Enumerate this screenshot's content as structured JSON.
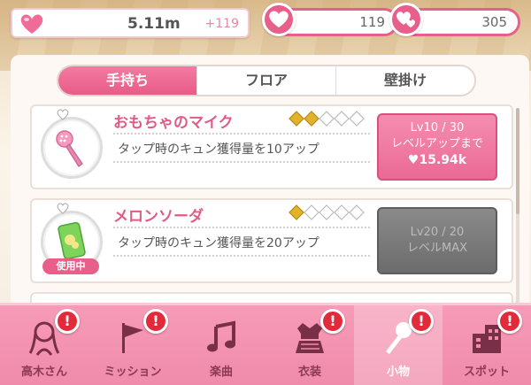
{
  "header": {
    "money_value": "5.11m",
    "money_delta": "+119",
    "heart_count": "119",
    "kyun_count": "305"
  },
  "tabs": [
    {
      "label": "手持ち",
      "active": true
    },
    {
      "label": "フロア",
      "active": false
    },
    {
      "label": "壁掛け",
      "active": false
    }
  ],
  "items": [
    {
      "name": "おもちゃのマイク",
      "description": "タップ時のキュン獲得量を10アップ",
      "rating": 2,
      "rating_max": 5,
      "level_text": "Lv10 / 30",
      "level_caption": "レベルアップまで",
      "cost": "♥15.94k",
      "button_state": "upgrade",
      "in_use": false
    },
    {
      "name": "メロンソーダ",
      "description": "タップ時のキュン獲得量を20アップ",
      "rating": 1,
      "rating_max": 5,
      "level_text": "Lv20 / 20",
      "level_caption": "レベルMAX",
      "cost": "",
      "button_state": "max",
      "in_use": true,
      "in_use_label": "使用中"
    }
  ],
  "nav": [
    {
      "label": "高木さん",
      "icon": "person-icon",
      "alert": "!"
    },
    {
      "label": "ミッション",
      "icon": "flag-icon",
      "alert": "!"
    },
    {
      "label": "楽曲",
      "icon": "music-note-icon",
      "alert": ""
    },
    {
      "label": "衣装",
      "icon": "costume-icon",
      "alert": "!"
    },
    {
      "label": "小物",
      "icon": "microphone-icon",
      "alert": "!",
      "active": true
    },
    {
      "label": "スポット",
      "icon": "building-icon",
      "alert": "!"
    }
  ],
  "colors": {
    "accent": "#e85f8c",
    "accent_light": "#f69bb8",
    "alert_red": "#e22b3a",
    "rating_gold": "#e2b32a"
  }
}
